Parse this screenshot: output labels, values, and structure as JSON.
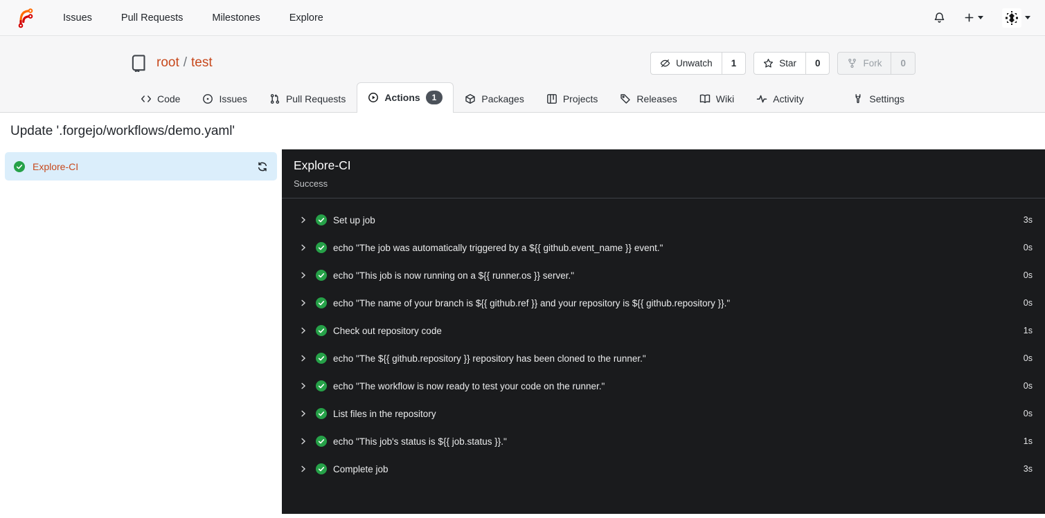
{
  "navbar": {
    "links": [
      {
        "label": "Issues"
      },
      {
        "label": "Pull Requests"
      },
      {
        "label": "Milestones"
      },
      {
        "label": "Explore"
      }
    ]
  },
  "repo": {
    "owner": "root",
    "separator": "/",
    "name": "test",
    "watch": {
      "label": "Unwatch",
      "count": "1"
    },
    "star": {
      "label": "Star",
      "count": "0"
    },
    "fork": {
      "label": "Fork",
      "count": "0"
    }
  },
  "tabs": [
    {
      "label": "Code"
    },
    {
      "label": "Issues"
    },
    {
      "label": "Pull Requests"
    },
    {
      "label": "Actions",
      "badge": "1",
      "active": true
    },
    {
      "label": "Packages"
    },
    {
      "label": "Projects"
    },
    {
      "label": "Releases"
    },
    {
      "label": "Wiki"
    },
    {
      "label": "Activity"
    },
    {
      "label": "Settings"
    }
  ],
  "page": {
    "title": "Update '.forgejo/workflows/demo.yaml'"
  },
  "sidebar": {
    "job": {
      "name": "Explore-CI",
      "status": "success"
    }
  },
  "run": {
    "title": "Explore-CI",
    "status": "Success",
    "steps": [
      {
        "name": "Set up job",
        "duration": "3s"
      },
      {
        "name": "echo \"The job was automatically triggered by a ${{ github.event_name }} event.\"",
        "duration": "0s"
      },
      {
        "name": "echo \"This job is now running on a ${{ runner.os }} server.\"",
        "duration": "0s"
      },
      {
        "name": "echo \"The name of your branch is ${{ github.ref }} and your repository is ${{ github.repository }}.\"",
        "duration": "0s"
      },
      {
        "name": "Check out repository code",
        "duration": "1s"
      },
      {
        "name": "echo \"The ${{ github.repository }} repository has been cloned to the runner.\"",
        "duration": "0s"
      },
      {
        "name": "echo \"The workflow is now ready to test your code on the runner.\"",
        "duration": "0s"
      },
      {
        "name": "List files in the repository",
        "duration": "0s"
      },
      {
        "name": "echo \"This job's status is ${{ job.status }}.\"",
        "duration": "1s"
      },
      {
        "name": "Complete job",
        "duration": "3s"
      }
    ]
  },
  "colors": {
    "accent_orange": "#c7481c",
    "status_green": "#26a148",
    "sidebar_active_bg": "#dbeefb",
    "panel_bg": "#1a1b1d",
    "badge_bg": "#4c525a",
    "header_bg": "#f6f6f7"
  }
}
